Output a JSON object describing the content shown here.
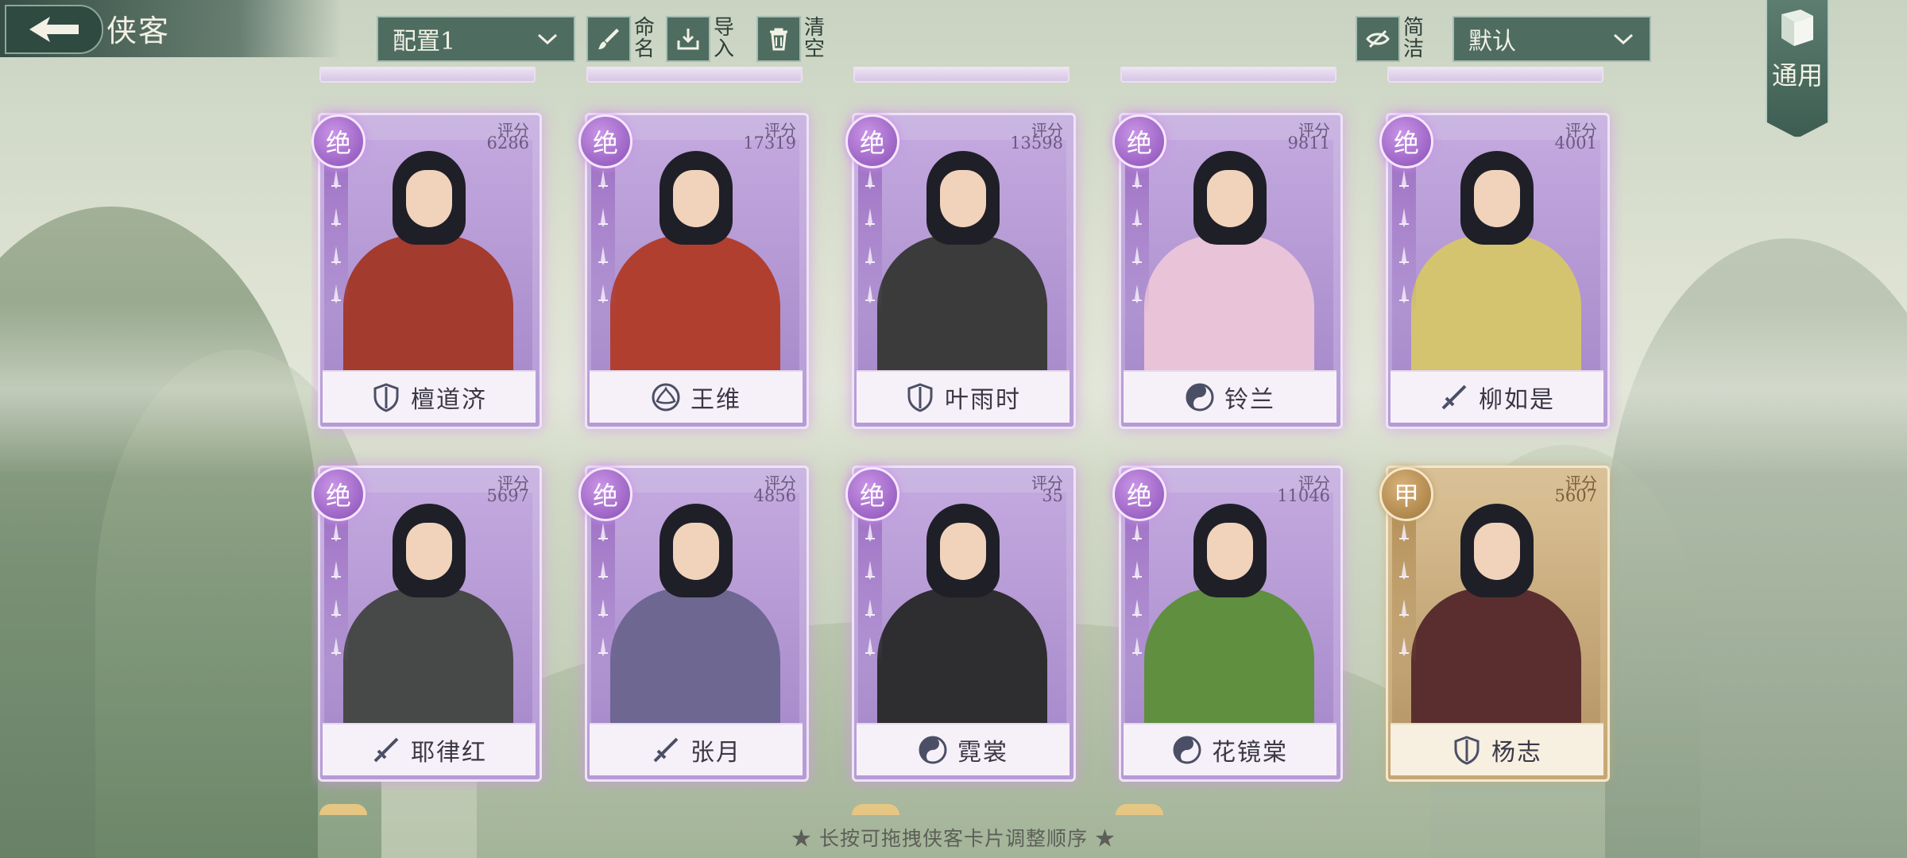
{
  "header": {
    "title": "侠客",
    "preset": "配置1",
    "rename": "命名",
    "import": "导入",
    "clear": "清空",
    "simple": "简洁",
    "sort": "默认",
    "general": "通用"
  },
  "score_label": "评分",
  "cards": [
    {
      "rank": "绝",
      "score": "6286",
      "name": "檀道济",
      "faction_icon": "shield-icon",
      "tier": "purple",
      "outfit": "#a33b2e"
    },
    {
      "rank": "绝",
      "score": "17319",
      "name": "王维",
      "faction_icon": "lotus-icon",
      "tier": "purple",
      "outfit": "#b13f2f"
    },
    {
      "rank": "绝",
      "score": "13598",
      "name": "叶雨时",
      "faction_icon": "shield-icon",
      "tier": "purple",
      "outfit": "#3a3b3a"
    },
    {
      "rank": "绝",
      "score": "9811",
      "name": "铃兰",
      "faction_icon": "yinyang-icon",
      "tier": "purple",
      "outfit": "#e9c3d8"
    },
    {
      "rank": "绝",
      "score": "4001",
      "name": "柳如是",
      "faction_icon": "sword-icon",
      "tier": "purple",
      "outfit": "#d5c46f"
    },
    {
      "rank": "绝",
      "score": "5697",
      "name": "耶律红",
      "faction_icon": "sword-icon",
      "tier": "purple",
      "outfit": "#474848"
    },
    {
      "rank": "绝",
      "score": "4856",
      "name": "张月",
      "faction_icon": "sword-icon",
      "tier": "purple",
      "outfit": "#6d6792"
    },
    {
      "rank": "绝",
      "score": "35",
      "name": "霓裳",
      "faction_icon": "yinyang-icon",
      "tier": "purple",
      "outfit": "#2e2d2f"
    },
    {
      "rank": "绝",
      "score": "11046",
      "name": "花镜棠",
      "faction_icon": "yinyang-icon",
      "tier": "purple",
      "outfit": "#5f8f3f"
    },
    {
      "rank": "甲",
      "score": "5607",
      "name": "杨志",
      "faction_icon": "shield-icon",
      "tier": "gold",
      "outfit": "#5a2e2f"
    }
  ],
  "hint": "★ 长按可拖拽侠客卡片调整顺序 ★",
  "colors": {
    "accent_panel": "#4e6d60",
    "purple_rank": "#8a4fb7",
    "gold_rank": "#a07638"
  }
}
